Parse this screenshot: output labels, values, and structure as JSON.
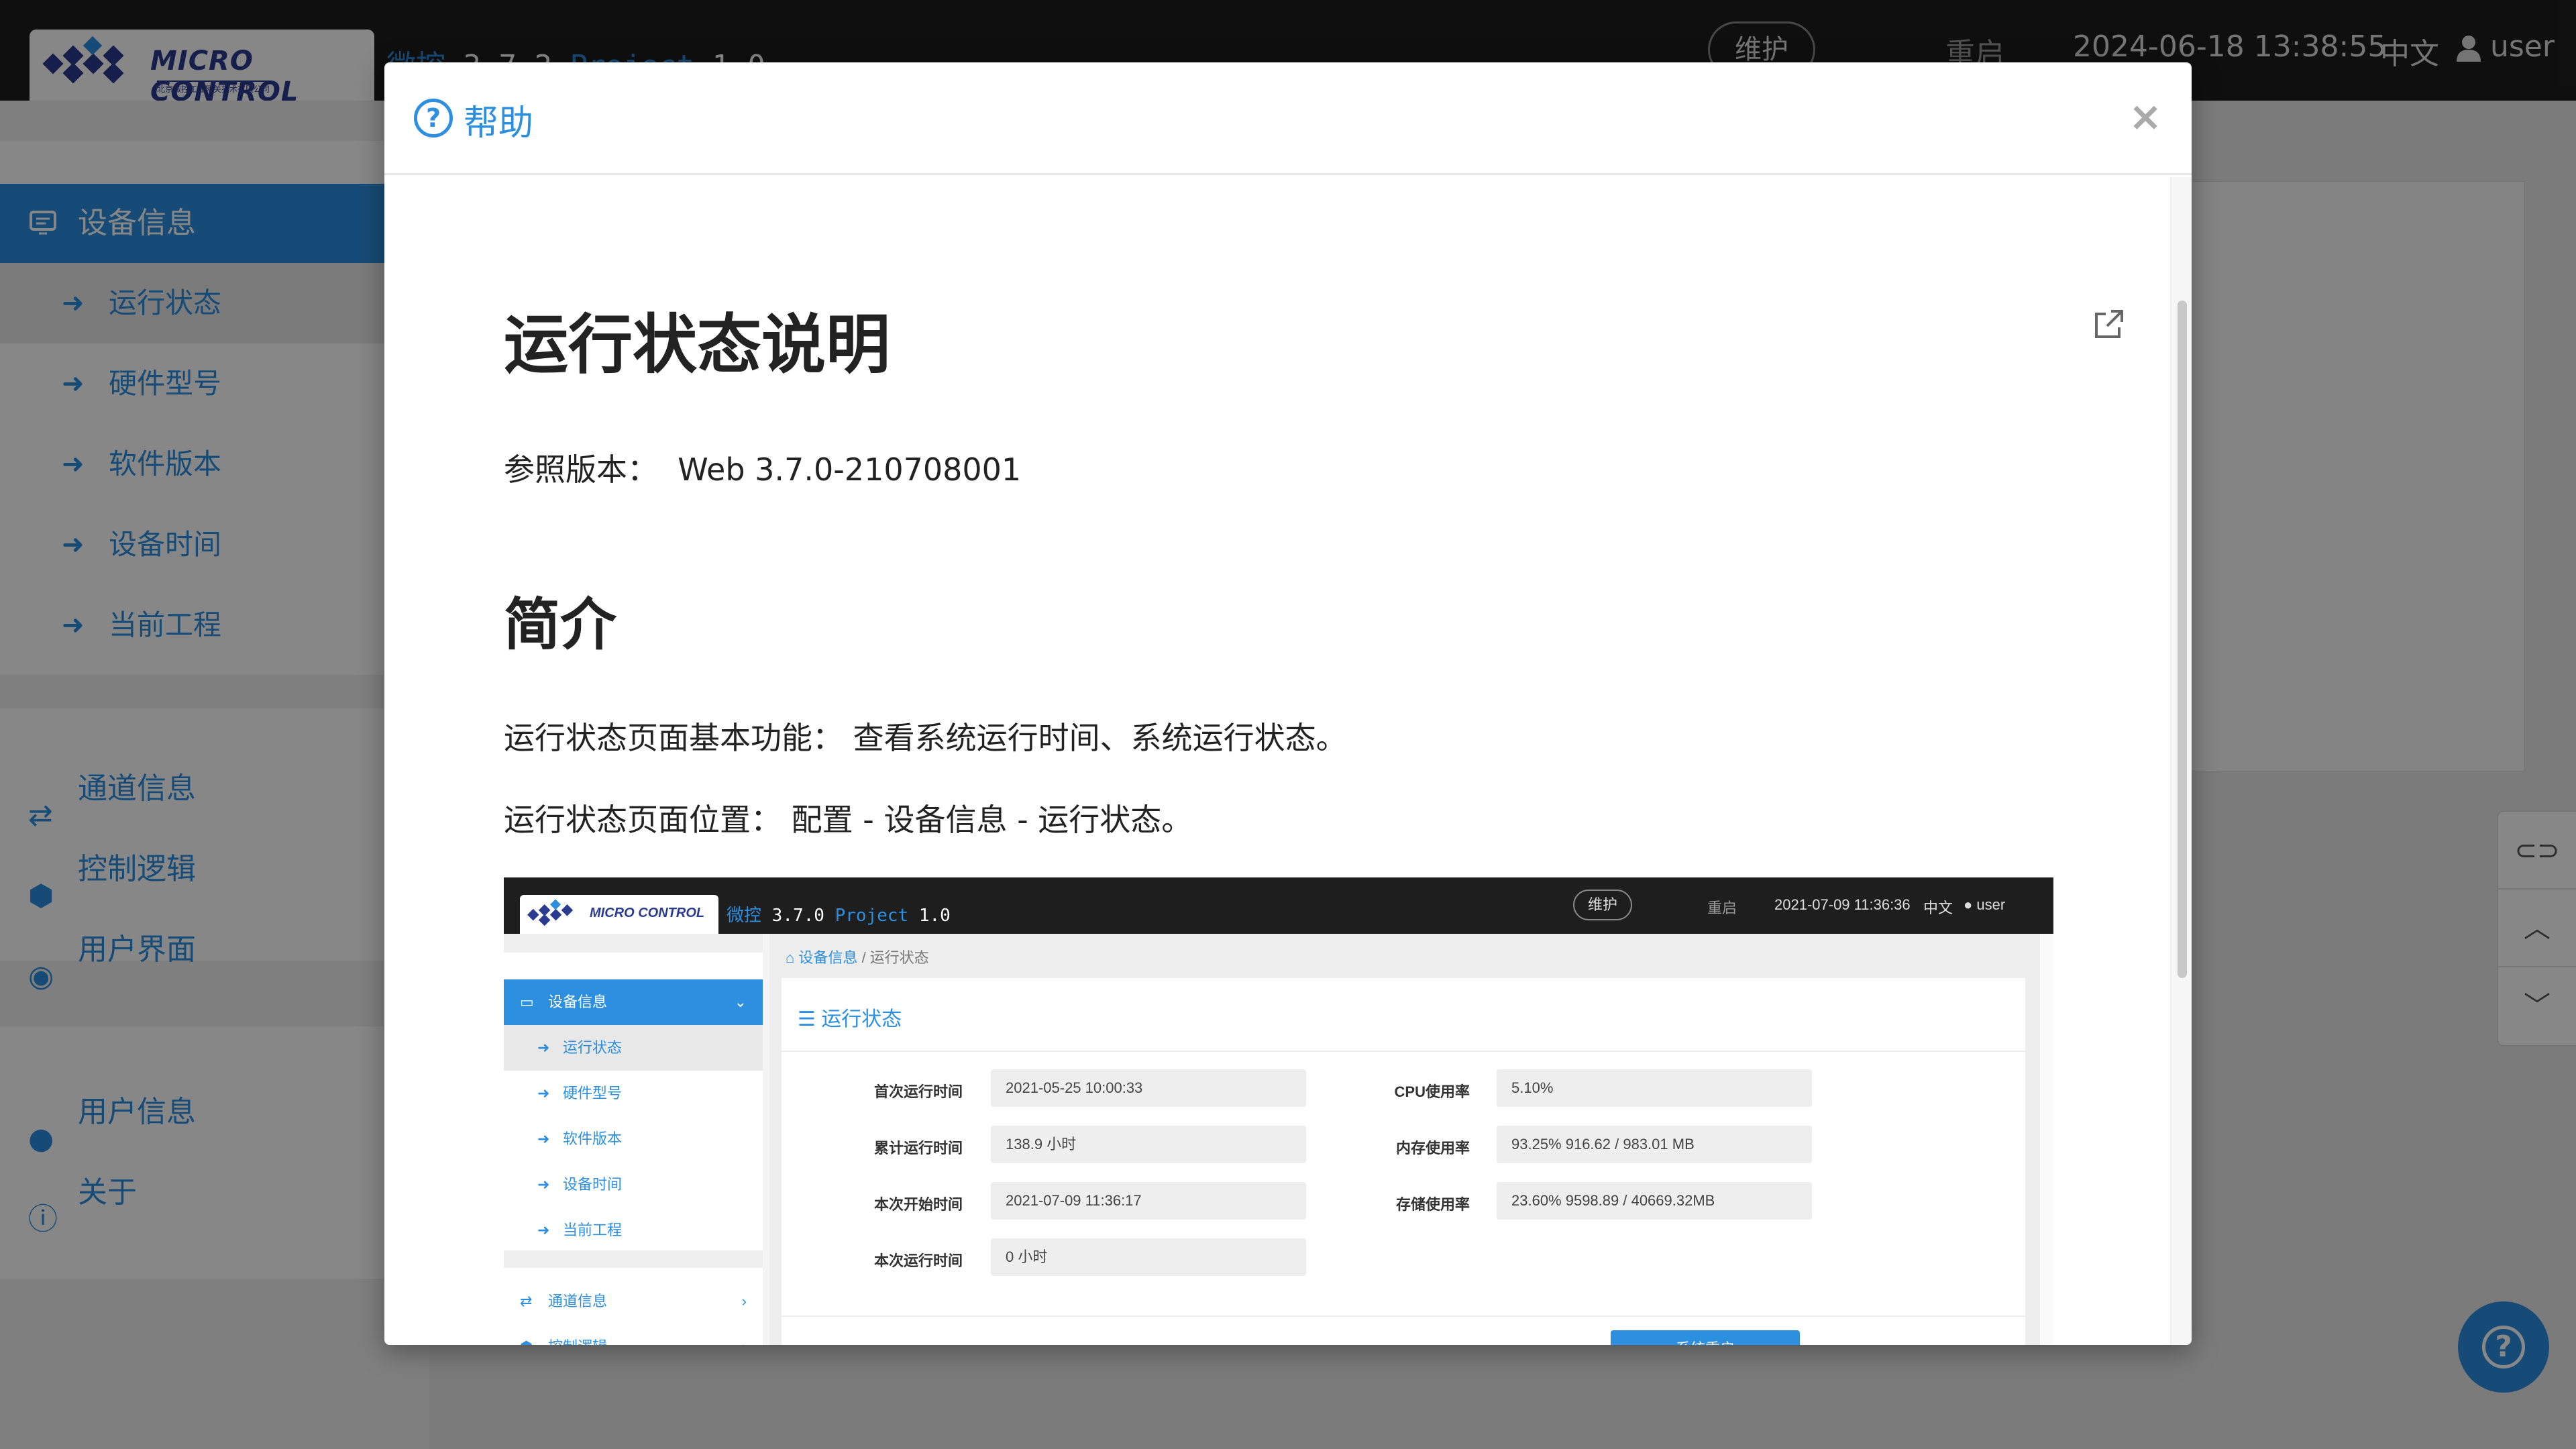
{
  "app": {
    "logo_text": "MICRO CONTROL",
    "logo_subtext": "北京微控工业网关技术有限公司",
    "title_name": "微控",
    "title_version": "3.7.2",
    "title_project": "Project",
    "title_project_version": "1.0",
    "maintenance_label": "维护",
    "restart_label": "重启",
    "datetime": "2024-06-18 13:38:55",
    "language": "中文",
    "user": "user"
  },
  "sidebar": {
    "group_label": "设备信息",
    "sub_items": [
      {
        "label": "运行状态"
      },
      {
        "label": "硬件型号"
      },
      {
        "label": "软件版本"
      },
      {
        "label": "设备时间"
      },
      {
        "label": "当前工程"
      }
    ],
    "main_items": [
      {
        "label": "通道信息",
        "icon": "exchange-icon"
      },
      {
        "label": "控制逻辑",
        "icon": "cube-icon"
      },
      {
        "label": "用户界面",
        "icon": "ui-icon"
      },
      {
        "label": "用户信息",
        "icon": "user-icon"
      },
      {
        "label": "关于",
        "icon": "info-icon"
      }
    ]
  },
  "modal": {
    "title": "帮助",
    "close_symbol": "×",
    "doc": {
      "heading": "运行状态说明",
      "version_label": "参照版本：",
      "version_value": "Web 3.7.0-210708001",
      "section_heading": "简介",
      "para1": "运行状态页面基本功能： 查看系统运行时间、系统运行状态。",
      "para2": "运行状态页面位置： 配置 - 设备信息 - 运行状态。"
    }
  },
  "screenshot": {
    "logo_text": "MICRO CONTROL",
    "title_name": "微控",
    "title_version": "3.7.0",
    "title_project": "Project",
    "title_project_version": "1.0",
    "maintenance_label": "维护",
    "restart_label": "重启",
    "datetime": "2021-07-09 11:36:36",
    "language": "中文",
    "user": "user",
    "breadcrumb": [
      "设备信息",
      "运行状态"
    ],
    "sidebar_group": "设备信息",
    "sidebar_sub": [
      "运行状态",
      "硬件型号",
      "软件版本",
      "设备时间",
      "当前工程"
    ],
    "sidebar_main": [
      "通道信息",
      "控制逻辑"
    ],
    "card_title": "运行状态",
    "fields_left": [
      {
        "label": "首次运行时间",
        "value": "2021-05-25 10:00:33"
      },
      {
        "label": "累计运行时间",
        "value": "138.9 小时"
      },
      {
        "label": "本次开始时间",
        "value": "2021-07-09 11:36:17"
      },
      {
        "label": "本次运行时间",
        "value": "0 小时"
      }
    ],
    "fields_right": [
      {
        "label": "CPU使用率",
        "value": "5.10%"
      },
      {
        "label": "内存使用率",
        "value": "93.25%  916.62 / 983.01 MB"
      },
      {
        "label": "存储使用率",
        "value": "23.60% 9598.89 / 40669.32MB"
      }
    ],
    "restart_button": "系统重启"
  },
  "colors": {
    "accent": "#2c8fe0",
    "topbar": "#1e1e1e",
    "overlay": "rgba(0,0,0,0.47)"
  }
}
